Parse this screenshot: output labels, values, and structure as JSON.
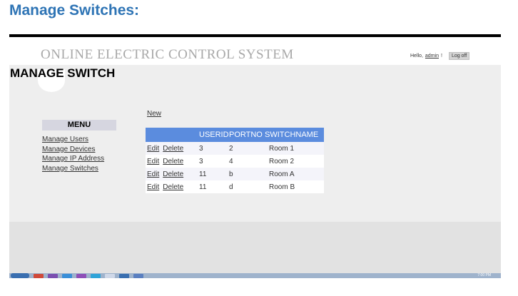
{
  "doc": {
    "heading": "Manage Switches:"
  },
  "app": {
    "brand": "ONLINE ELECTRIC CONTROL SYSTEM",
    "greeting_prefix": "Hello,",
    "username": "admin",
    "greeting_suffix": "!",
    "logoff_label": "Log off",
    "page_title": "MANAGE SWITCH"
  },
  "menu": {
    "title": "MENU",
    "items": [
      {
        "label": "Manage Users"
      },
      {
        "label": "Manage Devices"
      },
      {
        "label": "Manage IP Address"
      },
      {
        "label": "Manage Switches"
      }
    ]
  },
  "grid": {
    "new_label": "New",
    "columns": [
      "USERID",
      "PORTNO",
      "SWITCHNAME"
    ],
    "edit_label": "Edit",
    "delete_label": "Delete",
    "rows": [
      {
        "userid": "3",
        "portno": "2",
        "switchname": "Room 1"
      },
      {
        "userid": "3",
        "portno": "4",
        "switchname": "Room 2"
      },
      {
        "userid": "11",
        "portno": "b",
        "switchname": "Room A"
      },
      {
        "userid": "11",
        "portno": "d",
        "switchname": "Room B"
      }
    ]
  },
  "taskbar": {
    "clock": "7:00 PM",
    "icon_colors": [
      "#d04a3a",
      "#7b4fb0",
      "#3a8fd8",
      "#8f4fb8",
      "#2fa4d8",
      "#cfd8e8",
      "#3a6fb0",
      "#5a7fc0"
    ]
  }
}
